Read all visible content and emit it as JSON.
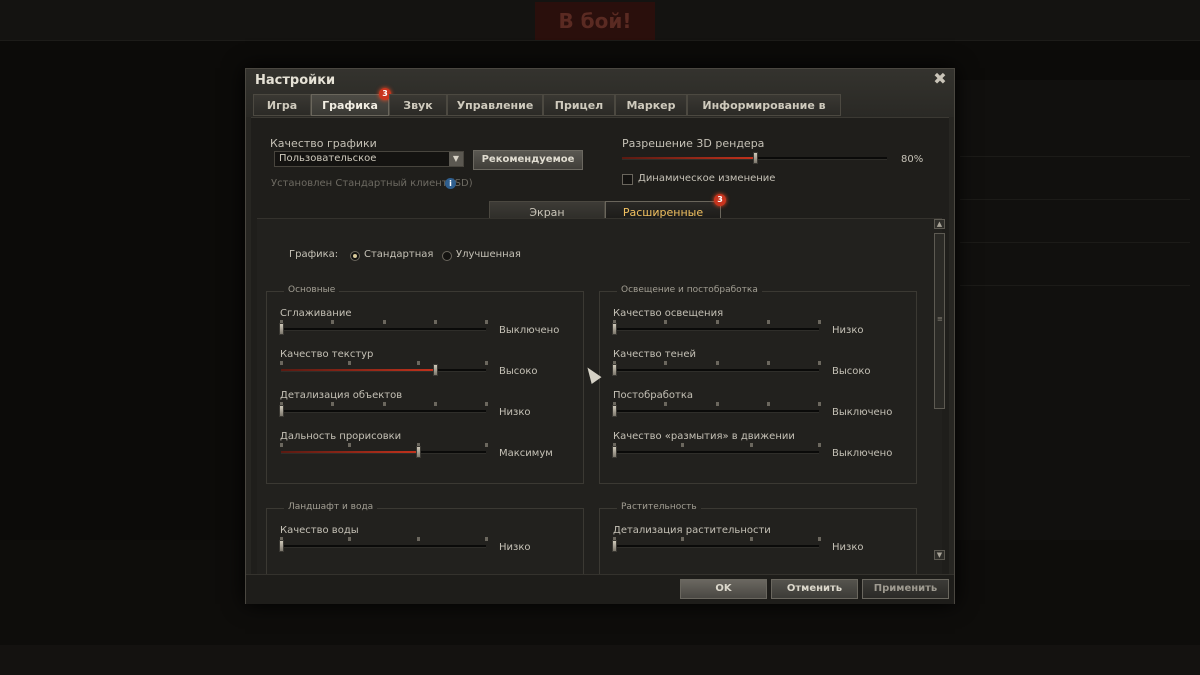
{
  "dialog": {
    "title": "Настройки",
    "tabs": [
      {
        "label": "Игра"
      },
      {
        "label": "Графика",
        "badge": "3"
      },
      {
        "label": "Звук"
      },
      {
        "label": "Управление"
      },
      {
        "label": "Прицел"
      },
      {
        "label": "Маркер"
      },
      {
        "label": "Информирование в бою"
      }
    ],
    "active_tab": "Графика"
  },
  "top": {
    "quality_label": "Качество графики",
    "quality_value": "Пользовательское",
    "recommended_button": "Рекомендуемое",
    "client_info": "Установлен Стандартный клиент (SD)",
    "info_icon": "i",
    "render_label": "Разрешение 3D рендера",
    "render_value": "80%",
    "render_level": 0.5,
    "dynamic_label": "Динамическое изменение",
    "dynamic_checked": false
  },
  "subtabs": [
    {
      "label": "Экран"
    },
    {
      "label": "Расширенные",
      "badge": "3"
    }
  ],
  "graphics_mode": {
    "label": "Графика:",
    "options": [
      "Стандартная",
      "Улучшенная"
    ],
    "selected": "Стандартная"
  },
  "groups": {
    "basic": {
      "title": "Основные",
      "items": [
        {
          "label": "Сглаживание",
          "value": "Выключено",
          "level": 0.0,
          "ticks": 5
        },
        {
          "label": "Качество текстур",
          "value": "Высоко",
          "level": 0.75,
          "ticks": 4
        },
        {
          "label": "Детализация объектов",
          "value": "Низко",
          "level": 0.0,
          "ticks": 5
        },
        {
          "label": "Дальность прорисовки",
          "value": "Максимум",
          "level": 0.67,
          "ticks": 4
        }
      ]
    },
    "lighting": {
      "title": "Освещение и постобработка",
      "items": [
        {
          "label": "Качество освещения",
          "value": "Низко",
          "level": 0.0,
          "ticks": 5
        },
        {
          "label": "Качество теней",
          "value": "Высоко",
          "level": 0.0,
          "ticks": 5
        },
        {
          "label": "Постобработка",
          "value": "Выключено",
          "level": 0.0,
          "ticks": 5
        },
        {
          "label": "Качество «размытия» в движении",
          "value": "Выключено",
          "level": 0.0,
          "ticks": 4
        }
      ]
    },
    "landscape": {
      "title": "Ландшафт и вода",
      "items": [
        {
          "label": "Качество воды",
          "value": "Низко",
          "level": 0.0,
          "ticks": 4
        }
      ]
    },
    "vegetation": {
      "title": "Растительность",
      "items": [
        {
          "label": "Детализация растительности",
          "value": "Низко",
          "level": 0.0,
          "ticks": 4
        }
      ]
    }
  },
  "footer": {
    "ok": "OK",
    "cancel": "Отменить",
    "apply": "Применить"
  },
  "background": {
    "battle_button": "В бой!"
  },
  "colors": {
    "badge": "#c8341e",
    "slider_fill": "#c3321c",
    "active_subtab_text": "#f0c060"
  },
  "icons": [
    "close-icon",
    "dropdown-arrow-icon",
    "info-icon",
    "scroll-up-icon",
    "scroll-down-icon",
    "mouse-cursor-icon"
  ]
}
